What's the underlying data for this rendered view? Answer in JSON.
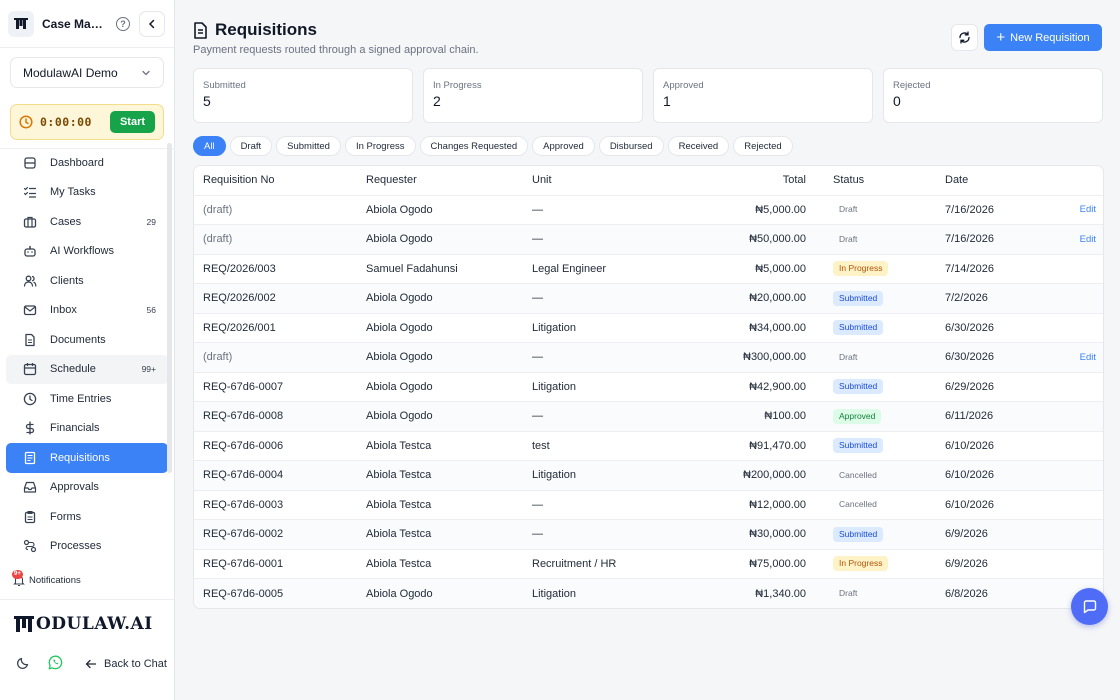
{
  "app": {
    "title": "Case Management"
  },
  "org": {
    "name": "ModulawAI Demo"
  },
  "timer": {
    "value": "0:00:00",
    "start_label": "Start"
  },
  "nav": [
    {
      "key": "dashboard",
      "label": "Dashboard",
      "count": "",
      "icon": "dashboard-icon"
    },
    {
      "key": "my-tasks",
      "label": "My Tasks",
      "count": "",
      "icon": "tasks-icon"
    },
    {
      "key": "cases",
      "label": "Cases",
      "count": "29",
      "icon": "briefcase-icon"
    },
    {
      "key": "ai-workflows",
      "label": "AI Workflows",
      "count": "",
      "icon": "bot-icon"
    },
    {
      "key": "clients",
      "label": "Clients",
      "count": "",
      "icon": "users-icon"
    },
    {
      "key": "inbox",
      "label": "Inbox",
      "count": "56",
      "icon": "mail-icon"
    },
    {
      "key": "documents",
      "label": "Documents",
      "count": "",
      "icon": "document-icon"
    },
    {
      "key": "schedule",
      "label": "Schedule",
      "count": "99+",
      "icon": "calendar-icon"
    },
    {
      "key": "time-entries",
      "label": "Time Entries",
      "count": "",
      "icon": "clock-icon"
    },
    {
      "key": "financials",
      "label": "Financials",
      "count": "",
      "icon": "dollar-icon"
    },
    {
      "key": "requisitions",
      "label": "Requisitions",
      "count": "",
      "icon": "requisition-icon"
    },
    {
      "key": "approvals",
      "label": "Approvals",
      "count": "",
      "icon": "inbox-tray-icon"
    },
    {
      "key": "forms",
      "label": "Forms",
      "count": "",
      "icon": "clipboard-icon"
    },
    {
      "key": "processes",
      "label": "Processes",
      "count": "",
      "icon": "workflow-icon"
    }
  ],
  "notifications": {
    "label": "Notifications",
    "badge": "9+"
  },
  "brand": {
    "text": "ODULAW.AI"
  },
  "footer": {
    "back_label": "Back to Chat"
  },
  "page": {
    "title": "Requisitions",
    "subtitle": "Payment requests routed through a signed approval chain.",
    "new_label": "New Requisition"
  },
  "stats": [
    {
      "label": "Submitted",
      "value": "5"
    },
    {
      "label": "In Progress",
      "value": "2"
    },
    {
      "label": "Approved",
      "value": "1"
    },
    {
      "label": "Rejected",
      "value": "0"
    }
  ],
  "filters": [
    "All",
    "Draft",
    "Submitted",
    "In Progress",
    "Changes Requested",
    "Approved",
    "Disbursed",
    "Received",
    "Rejected"
  ],
  "table": {
    "headers": {
      "no": "Requisition No",
      "requester": "Requester",
      "unit": "Unit",
      "total": "Total",
      "status": "Status",
      "date": "Date"
    },
    "edit_label": "Edit",
    "rows": [
      {
        "no": "(draft)",
        "requester": "Abiola Ogodo",
        "unit": "—",
        "total": "₦5,000.00",
        "status": "Draft",
        "date": "7/16/2026",
        "edit": true
      },
      {
        "no": "(draft)",
        "requester": "Abiola Ogodo",
        "unit": "—",
        "total": "₦50,000.00",
        "status": "Draft",
        "date": "7/16/2026",
        "edit": true
      },
      {
        "no": "REQ/2026/003",
        "requester": "Samuel Fadahunsi",
        "unit": "Legal Engineer",
        "total": "₦5,000.00",
        "status": "In Progress",
        "date": "7/14/2026",
        "edit": false
      },
      {
        "no": "REQ/2026/002",
        "requester": "Abiola Ogodo",
        "unit": "—",
        "total": "₦20,000.00",
        "status": "Submitted",
        "date": "7/2/2026",
        "edit": false
      },
      {
        "no": "REQ/2026/001",
        "requester": "Abiola Ogodo",
        "unit": "Litigation",
        "total": "₦34,000.00",
        "status": "Submitted",
        "date": "6/30/2026",
        "edit": false
      },
      {
        "no": "(draft)",
        "requester": "Abiola Ogodo",
        "unit": "—",
        "total": "₦300,000.00",
        "status": "Draft",
        "date": "6/30/2026",
        "edit": true
      },
      {
        "no": "REQ-67d6-0007",
        "requester": "Abiola Ogodo",
        "unit": "Litigation",
        "total": "₦42,900.00",
        "status": "Submitted",
        "date": "6/29/2026",
        "edit": false
      },
      {
        "no": "REQ-67d6-0008",
        "requester": "Abiola Ogodo",
        "unit": "—",
        "total": "₦100.00",
        "status": "Approved",
        "date": "6/11/2026",
        "edit": false
      },
      {
        "no": "REQ-67d6-0006",
        "requester": "Abiola Testca",
        "unit": "test",
        "total": "₦91,470.00",
        "status": "Submitted",
        "date": "6/10/2026",
        "edit": false
      },
      {
        "no": "REQ-67d6-0004",
        "requester": "Abiola Testca",
        "unit": "Litigation",
        "total": "₦200,000.00",
        "status": "Cancelled",
        "date": "6/10/2026",
        "edit": false
      },
      {
        "no": "REQ-67d6-0003",
        "requester": "Abiola Testca",
        "unit": "—",
        "total": "₦12,000.00",
        "status": "Cancelled",
        "date": "6/10/2026",
        "edit": false
      },
      {
        "no": "REQ-67d6-0002",
        "requester": "Abiola Testca",
        "unit": "—",
        "total": "₦30,000.00",
        "status": "Submitted",
        "date": "6/9/2026",
        "edit": false
      },
      {
        "no": "REQ-67d6-0001",
        "requester": "Abiola Testca",
        "unit": "Recruitment / HR",
        "total": "₦75,000.00",
        "status": "In Progress",
        "date": "6/9/2026",
        "edit": false
      },
      {
        "no": "REQ-67d6-0005",
        "requester": "Abiola Ogodo",
        "unit": "Litigation",
        "total": "₦1,340.00",
        "status": "Draft",
        "date": "6/8/2026",
        "edit": false
      }
    ]
  },
  "colors": {
    "accent": "#3b82f6",
    "start": "#16a34a",
    "fab": "#4f6cf7"
  }
}
